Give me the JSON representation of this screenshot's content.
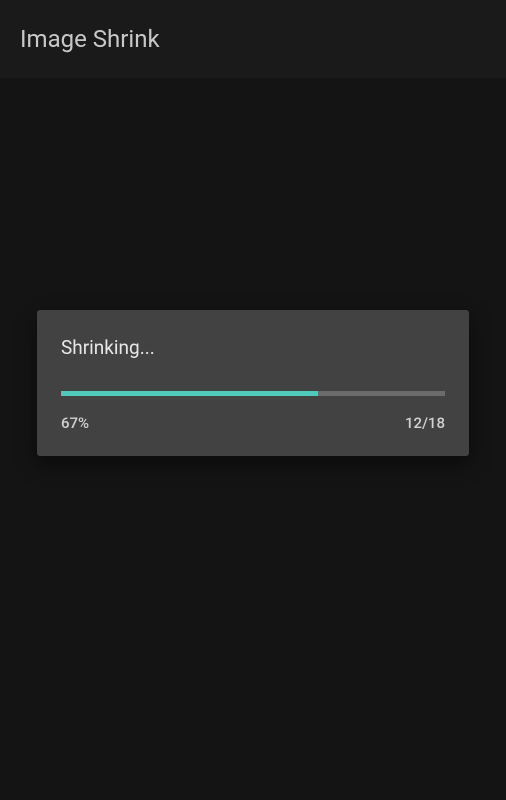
{
  "header": {
    "title": "Image Shrink"
  },
  "dialog": {
    "title": "Shrinking...",
    "progress_percent": "67%",
    "progress_count": "12/18",
    "progress_value": 67
  },
  "colors": {
    "accent": "#4fc9bb",
    "background": "#141414",
    "header_bg": "#1a1a1a",
    "dialog_bg": "#424242"
  }
}
